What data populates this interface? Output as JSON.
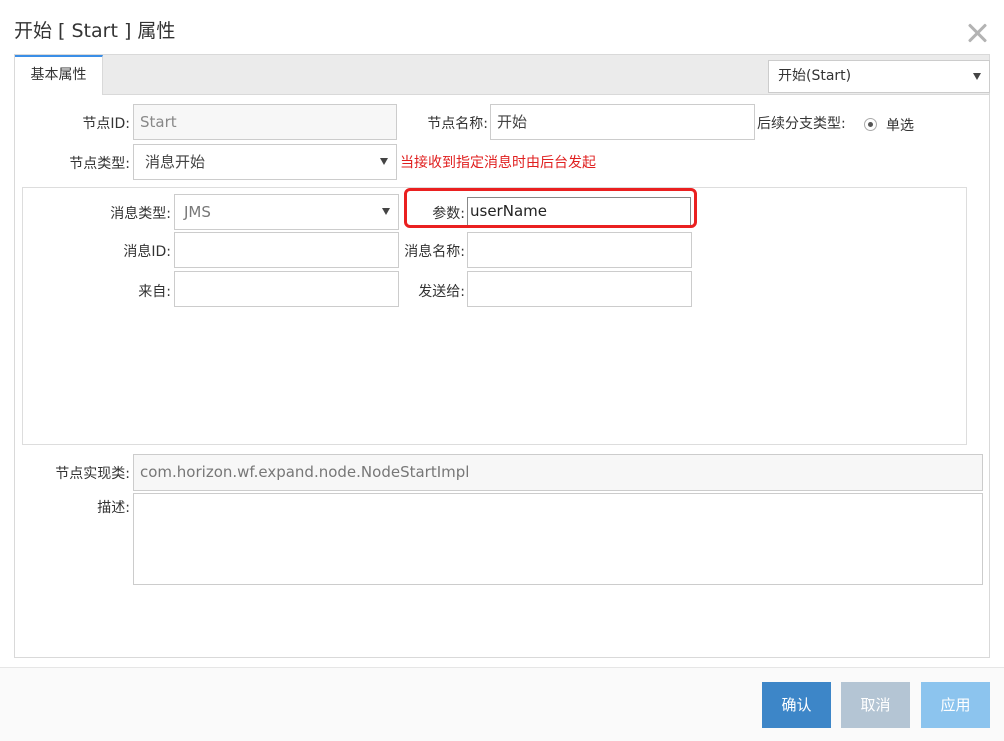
{
  "dialog": {
    "title": "开始 [ Start ] 属性"
  },
  "tabs": [
    {
      "label": "基本属性",
      "active": true
    }
  ],
  "node_selector": {
    "value": "开始(Start)"
  },
  "form": {
    "node_id": {
      "label": "节点ID:",
      "value": "Start"
    },
    "node_name": {
      "label": "节点名称:",
      "value": "开始"
    },
    "branch_type": {
      "label": "后续分支类型:",
      "option_label": "单选",
      "selected": true
    },
    "node_type": {
      "label": "节点类型:",
      "value": "消息开始",
      "hint": "当接收到指定消息时由后台发起"
    },
    "message": {
      "type": {
        "label": "消息类型:",
        "value": "JMS"
      },
      "param": {
        "label": "参数:",
        "value": "userName"
      },
      "message_id": {
        "label": "消息ID:",
        "value": ""
      },
      "message_name": {
        "label": "消息名称:",
        "value": ""
      },
      "from": {
        "label": "来自:",
        "value": ""
      },
      "send_to": {
        "label": "发送给:",
        "value": ""
      }
    },
    "impl_class": {
      "label": "节点实现类:",
      "value": "com.horizon.wf.expand.node.NodeStartImpl"
    },
    "description": {
      "label": "描述:",
      "value": ""
    }
  },
  "buttons": {
    "confirm": "确认",
    "cancel": "取消",
    "apply": "应用"
  },
  "colors": {
    "highlight": "#ea2020",
    "hint_text": "#e02020",
    "confirm_button": "#3d86c8",
    "cancel_button": "#b4c5d4",
    "apply_button": "#8cc4ee",
    "tab_accent": "#3b8ee6"
  },
  "icons": {
    "close": "close-icon",
    "dropdown": "chevron-down-icon"
  }
}
